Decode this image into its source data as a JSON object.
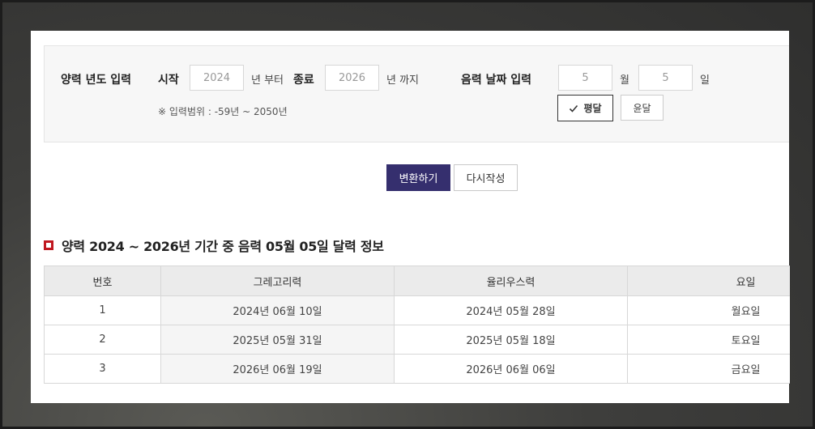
{
  "form": {
    "solar_year_label": "양력 년도 입력",
    "start_label": "시작",
    "start_value": "2024",
    "from_label": "년 부터",
    "end_label": "종료",
    "end_value": "2026",
    "to_label": "년 까지",
    "range_note": "※ 입력범위 : -59년 ~ 2050년",
    "lunar_date_label": "음력 날짜 입력",
    "month_value": "5",
    "month_label": "월",
    "day_value": "5",
    "day_label": "일",
    "normal_month_label": "평달",
    "leap_month_label": "윤달"
  },
  "actions": {
    "convert_label": "변환하기",
    "reset_label": "다시작성"
  },
  "result": {
    "title": "양력 2024 ~ 2026년 기간 중 음력 05월 05일 달력 정보",
    "columns": [
      "번호",
      "그레고리력",
      "율리우스력",
      "요일"
    ],
    "rows": [
      {
        "no": "1",
        "gregorian": "2024년 06월 10일",
        "julian": "2024년 05월 28일",
        "weekday": "월요일"
      },
      {
        "no": "2",
        "gregorian": "2025년 05월 31일",
        "julian": "2025년 05월 18일",
        "weekday": "토요일"
      },
      {
        "no": "3",
        "gregorian": "2026년 06월 19일",
        "julian": "2026년 06월 06일",
        "weekday": "금요일"
      }
    ]
  },
  "colors": {
    "accent": "#352f6e",
    "title_marker": "#c0171f"
  }
}
